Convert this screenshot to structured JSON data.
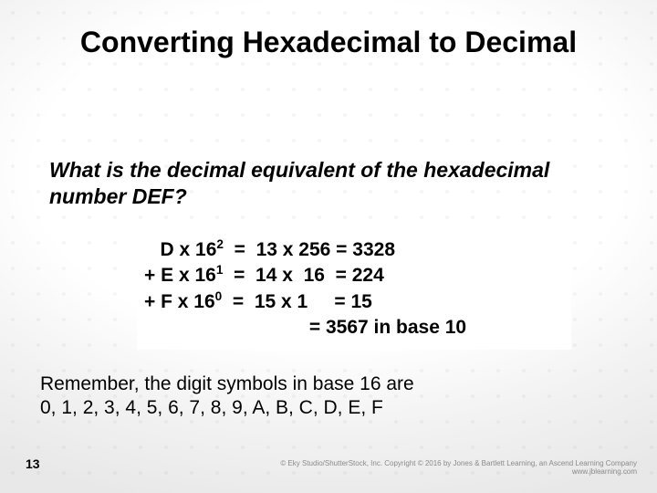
{
  "title": "Converting Hexadecimal to Decimal",
  "question": "What is the decimal equivalent of the hexadecimal number DEF?",
  "calc": {
    "rows": [
      {
        "prefix": "   ",
        "digit": "D",
        "op": " x 16",
        "exp": "2",
        "rhs": "  =  13 x 256 = 3328"
      },
      {
        "prefix": "+ ",
        "digit": "E",
        "op": " x 16",
        "exp": "1",
        "rhs": "  =  14 x  16  = 224"
      },
      {
        "prefix": "+ ",
        "digit": "F",
        "op": " x 16",
        "exp": "0",
        "rhs": "  =  15 x 1     = 15"
      }
    ],
    "result": "                               = 3567 in base 10"
  },
  "note_line1": "Remember, the digit symbols in base 16 are",
  "note_line2": "0, 1, 2, 3, 4, 5, 6, 7, 8, 9, A, B, C, D, E, F",
  "page_number": "13",
  "footer_credit_line1": "© Eky Studio/ShutterStock, Inc. Copyright © 2016 by Jones & Bartlett Learning, an Ascend Learning Company",
  "footer_credit_line2": "www.jblearning.com"
}
